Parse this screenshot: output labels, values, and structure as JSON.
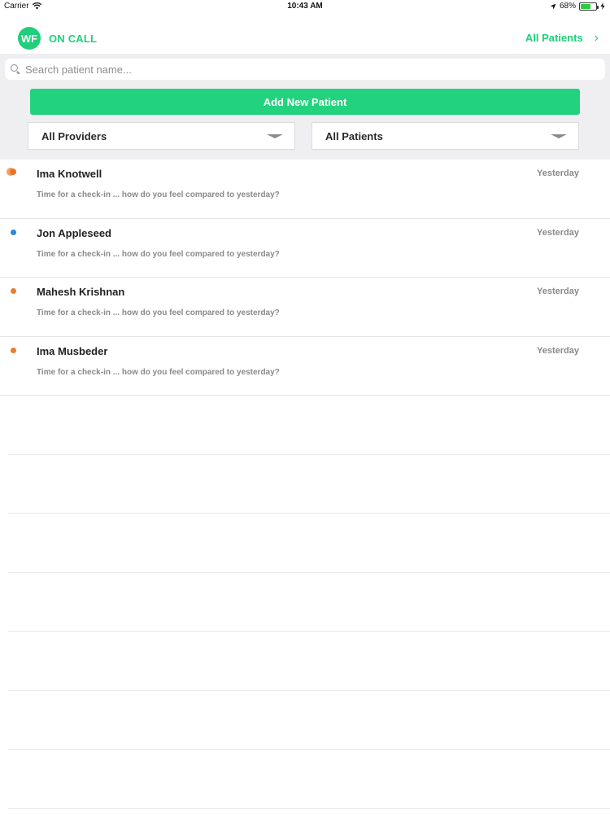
{
  "status_bar": {
    "carrier": "Carrier",
    "time": "10:43 AM",
    "battery": "68%",
    "battery_level": 0.68
  },
  "header": {
    "avatar_initials": "WF",
    "title": "ON CALL",
    "right_link": "All Patients"
  },
  "search": {
    "placeholder": "Search patient name..."
  },
  "add_button": {
    "label": "Add New Patient"
  },
  "filters": {
    "providers": "All Providers",
    "patients": "All Patients"
  },
  "patients": [
    {
      "name": "Ima Knotwell",
      "date": "Yesterday",
      "message": "Time for a check-in ... how do you feel compared to yesterday?",
      "status_color": "#ef8a3a"
    },
    {
      "name": "Jon Appleseed",
      "date": "Yesterday",
      "message": "Time for a check-in ... how do you feel compared to yesterday?",
      "status_color": "#2a86d8"
    },
    {
      "name": "Mahesh Krishnan",
      "date": "Yesterday",
      "message": "Time for a check-in ... how do you feel compared to yesterday?",
      "status_color": "#ea7d2f"
    },
    {
      "name": "Ima Musbeder",
      "date": "Yesterday",
      "message": "Time for a check-in ... how do you feel compared to yesterday?",
      "status_color": "#ea7d2f"
    }
  ],
  "colors": {
    "accent": "#1fcf7a",
    "button": "#22d27e",
    "controls_bg": "#efeff2"
  }
}
